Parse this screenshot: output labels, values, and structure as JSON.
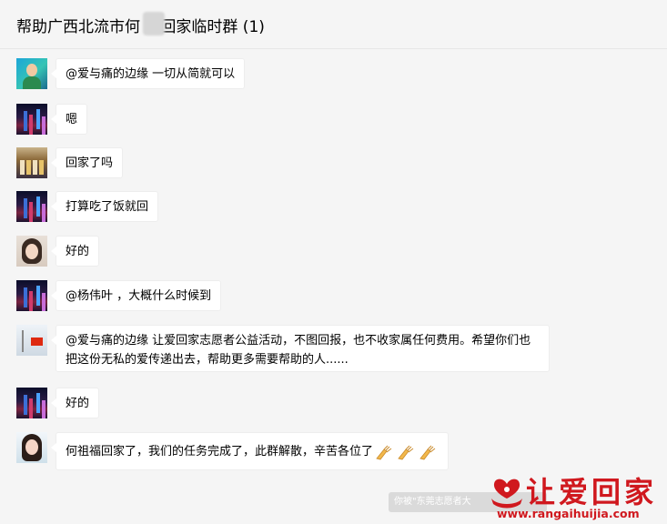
{
  "header": {
    "title": "帮助广西北流市何  福回家临时群 (1)"
  },
  "messages": [
    {
      "avatar": "tech-boy-avatar",
      "text": "@爱与痛的边缘 一切从简就可以"
    },
    {
      "avatar": "night-city-avatar",
      "text": "嗯"
    },
    {
      "avatar": "stage-avatar",
      "text": "回家了吗"
    },
    {
      "avatar": "night-city-avatar",
      "text": "打算吃了饭就回"
    },
    {
      "avatar": "girl-avatar",
      "text": "好的"
    },
    {
      "avatar": "night-city-avatar",
      "text": "@杨伟叶 ，大概什么时候到"
    },
    {
      "avatar": "flag-avatar",
      "text": "@爱与痛的边缘 让爱回家志愿者公益活动，不图回报，也不收家属任何费用。希望你们也把这份无私的爱传递出去，帮助更多需要帮助的人......"
    },
    {
      "avatar": "night-city-avatar",
      "text": "好的"
    },
    {
      "avatar": "woman-avatar",
      "text": "何祖福回家了，我们的任务完成了，此群解散，辛苦各位了",
      "emoji": "clapping-hands-icon"
    }
  ],
  "system_notice": "你被\"东莞志愿者大",
  "watermark": {
    "text": "让爱回家",
    "url": "www.rangaihuijia.com"
  },
  "colors": {
    "background": "#f5f5f5",
    "bubble": "#ffffff",
    "watermark_red": "#d0181e"
  }
}
